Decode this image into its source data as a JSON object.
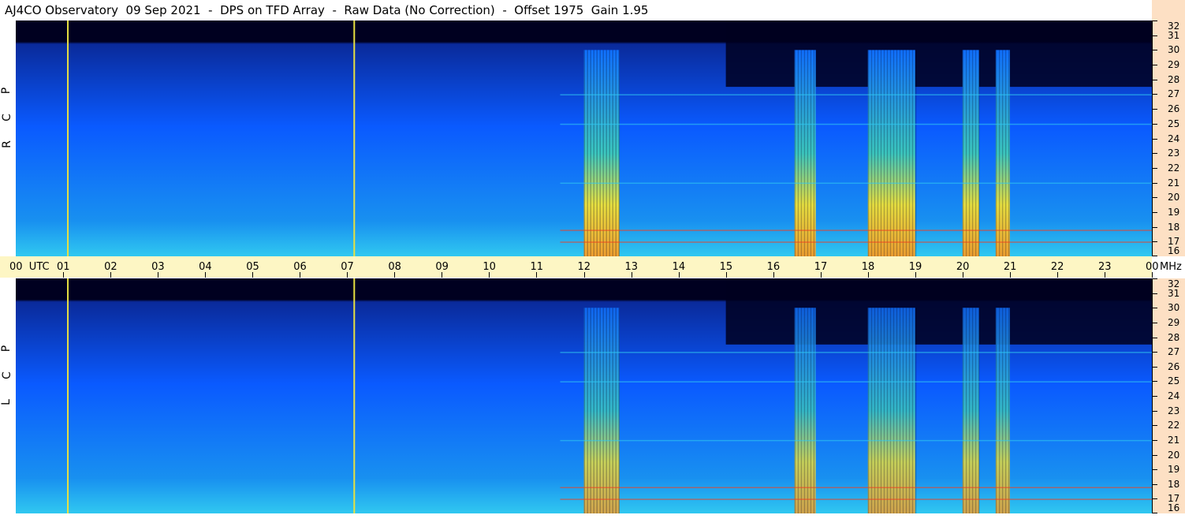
{
  "title": "AJ4CO Observatory  09 Sep 2021  -  DPS on TFD Array  -  Raw Data (No Correction)  -  Offset 1975  Gain 1.95",
  "panels": [
    {
      "id": "rcp",
      "side_label": [
        "R",
        "C",
        "P"
      ]
    },
    {
      "id": "lcp",
      "side_label": [
        "L",
        "C",
        "P"
      ]
    }
  ],
  "time_axis": {
    "labels": [
      "00  UTC",
      "01",
      "02",
      "03",
      "04",
      "05",
      "06",
      "07",
      "08",
      "09",
      "10",
      "11",
      "12",
      "13",
      "14",
      "15",
      "16",
      "17",
      "18",
      "19",
      "20",
      "21",
      "22",
      "23",
      "00"
    ],
    "unit_right": "MHz"
  },
  "freq_axis": {
    "labels": [
      "32",
      "31",
      "30",
      "29",
      "28",
      "27",
      "26",
      "25",
      "24",
      "23",
      "22",
      "21",
      "20",
      "19",
      "18",
      "17",
      "16"
    ]
  },
  "colors": {
    "background_dark": "#000020",
    "spectrum_blue": "#0a5aff",
    "noise_cyan": "#30c8f0",
    "burst_yellow": "#e8e040",
    "burst_red": "#f04020",
    "time_axis_bg": "#fdf6c4",
    "freq_axis_bg": "#fde0c4"
  },
  "chart_data": {
    "type": "heatmap",
    "title": "AJ4CO Observatory  09 Sep 2021  -  DPS on TFD Array  -  Raw Data (No Correction)  -  Offset 1975  Gain 1.95",
    "xlabel": "UTC",
    "ylabel": "MHz",
    "x_range_utc_hours": [
      0,
      24
    ],
    "y_range_mhz": [
      16,
      32
    ],
    "panels": [
      "RCP",
      "LCP"
    ],
    "interference_lines_utc": [
      1.1,
      7.15
    ],
    "noise_bursts": [
      {
        "start_utc": 12.0,
        "end_utc": 12.75
      },
      {
        "start_utc": 16.45,
        "end_utc": 16.9
      },
      {
        "start_utc": 18.0,
        "end_utc": 19.0
      },
      {
        "start_utc": 20.0,
        "end_utc": 20.35
      },
      {
        "start_utc": 20.7,
        "end_utc": 21.0
      }
    ]
  }
}
